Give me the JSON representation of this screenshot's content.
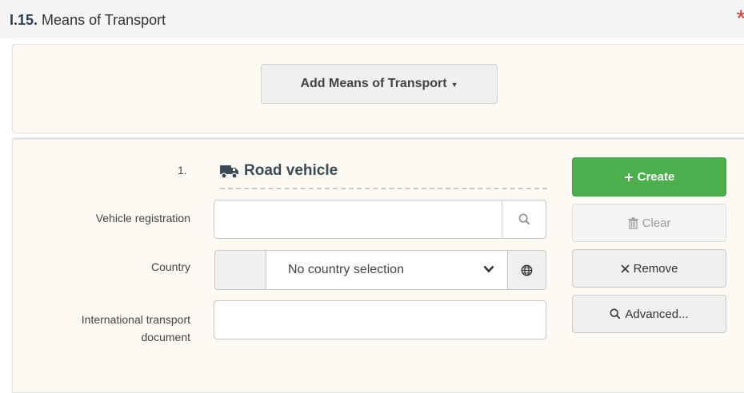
{
  "section": {
    "code": "I.15.",
    "title": "Means of Transport",
    "required_mark": "*"
  },
  "add_button": {
    "label": "Add Means of Transport"
  },
  "transport_item": {
    "number": "1.",
    "type_label": "Road vehicle",
    "icon": "truck-icon",
    "fields": {
      "vehicle_registration": {
        "label": "Vehicle registration",
        "value": "",
        "placeholder": ""
      },
      "country": {
        "label": "Country",
        "selected": "No country selection"
      },
      "international_transport_document": {
        "label_line1": "International transport",
        "label_line2": "document",
        "value": "",
        "placeholder": ""
      }
    }
  },
  "actions": {
    "create": "Create",
    "clear": "Clear",
    "remove": "Remove",
    "advanced": "Advanced..."
  },
  "colors": {
    "create_bg": "#4cae4c",
    "required": "#e03333",
    "panel_bg": "#fcfaf2"
  }
}
